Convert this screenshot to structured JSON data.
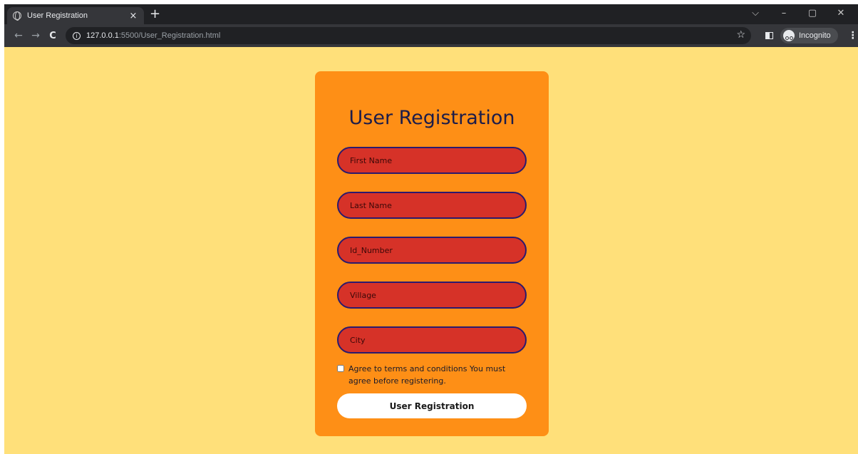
{
  "browser": {
    "tab_title": "User Registration",
    "tab_close": "×",
    "new_tab": "+",
    "window_controls": {
      "dropdown": "⌵",
      "minimize": "–",
      "restore": "▢",
      "close": "✕"
    },
    "nav": {
      "back": "←",
      "forward": "→",
      "reload": "C"
    },
    "url_host": "127.0.0.1",
    "url_rest": ":5500/User_Registration.html",
    "bookmark_star": "☆",
    "incognito_label": "Incognito",
    "menu": "⋮"
  },
  "form": {
    "title": "User Registration",
    "fields": [
      {
        "placeholder": "First Name"
      },
      {
        "placeholder": "Last Name"
      },
      {
        "placeholder": "Id_Number"
      },
      {
        "placeholder": "Village"
      },
      {
        "placeholder": "City"
      }
    ],
    "terms_text": "Agree to terms and conditions You must agree before registering.",
    "terms_checked": false,
    "submit_label": "User Registration"
  },
  "colors": {
    "page_background": "#ffe07a",
    "card": "#fe8f16",
    "field": "#d63228",
    "field_border": "#2a1a6e",
    "title": "#1c1c4a",
    "button": "#ffffff"
  },
  "icons": [
    "globe-icon",
    "info-icon",
    "star-icon",
    "side-panel-icon",
    "incognito-icon",
    "menu-icon"
  ]
}
